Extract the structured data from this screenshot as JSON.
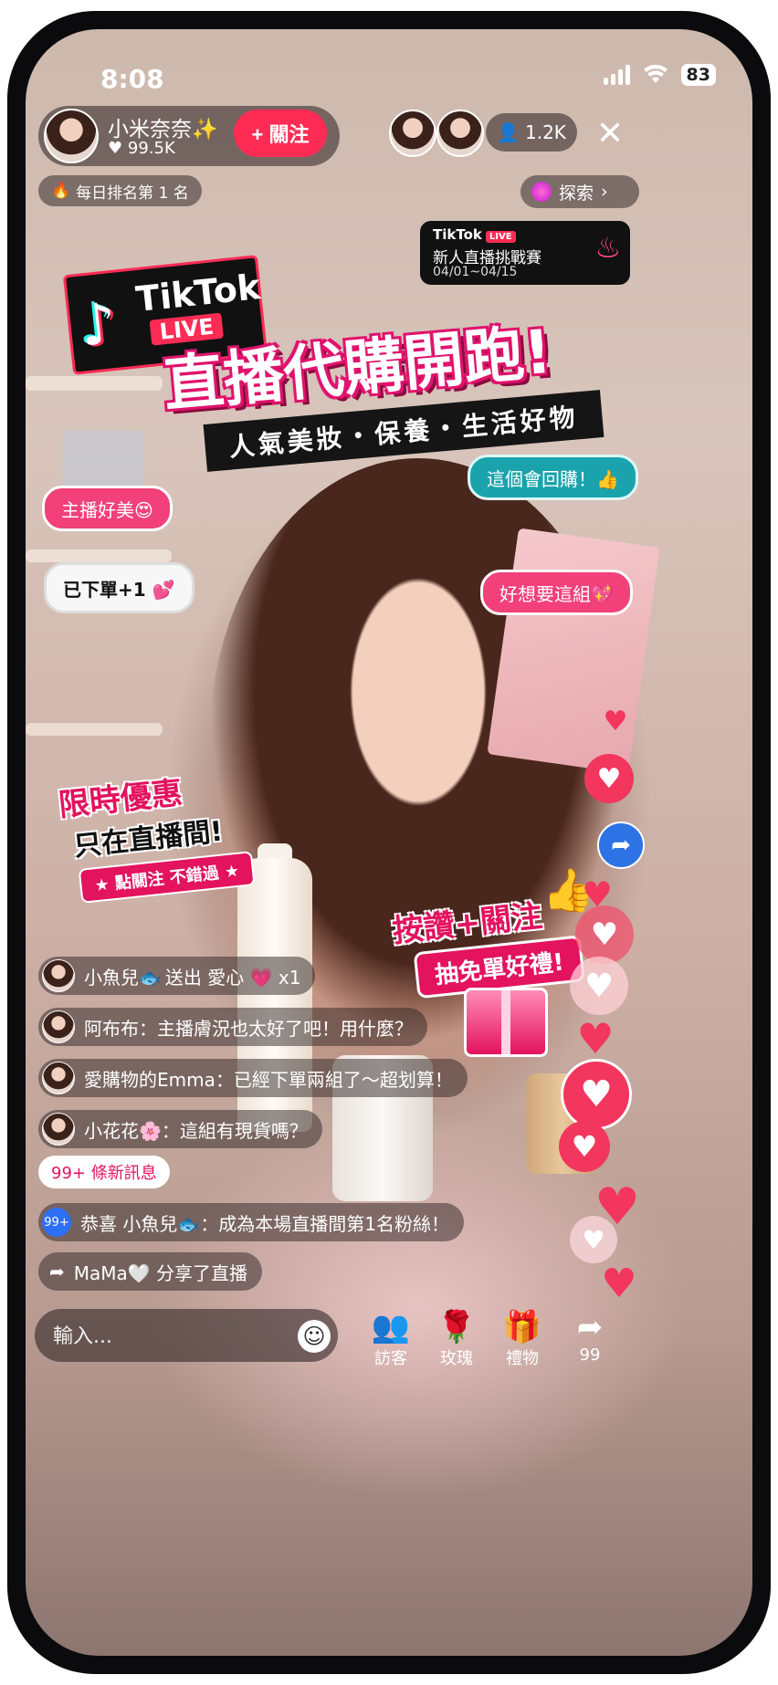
{
  "status": {
    "time": "8:08",
    "battery": "83"
  },
  "host": {
    "name": "小米奈奈✨",
    "likes": "99.5K",
    "follow_label": "+ 關注"
  },
  "viewers": {
    "count": "1.2K"
  },
  "rank": {
    "label": "每日排名第 1 名"
  },
  "explore": {
    "label": "探索"
  },
  "challenge": {
    "brand": "TikTok",
    "live": "LIVE",
    "title": "新人直播挑戰賽",
    "dates": "04/01~04/15"
  },
  "hero": {
    "logo_word": "TikTok",
    "logo_live": "LIVE",
    "headline": "直播代購開跑!",
    "subline": "人氣美妝・保養・生活好物"
  },
  "bubbles": {
    "b1": "主播好美😍",
    "b2": "已下單+1 💕",
    "b3": "這個會回購！👍",
    "b4": "好想要這組💖"
  },
  "promo": {
    "limited": "限時優惠",
    "only": "只在直播間!",
    "follow_tag": "★ 點關注 不錯過 ★",
    "like_follow": "按讚+關注",
    "free_gift": "抽免單好禮!"
  },
  "chat": [
    {
      "user": "小魚兒🐟",
      "text": "送出 愛心 💗 x1"
    },
    {
      "user": "阿布布：",
      "text": "主播膚況也太好了吧！用什麼？"
    },
    {
      "user": "愛購物的Emma：",
      "text": "已經下單兩組了～超划算！"
    },
    {
      "user": "小花花🌸：",
      "text": "這組有現貨嗎？"
    }
  ],
  "new_messages": "99+ 條新訊息",
  "system_badge": "99+",
  "system_msg": "恭喜 小魚兒🐟：成為本場直播間第1名粉絲！",
  "share_msg": "MaMa🤍 分享了直播",
  "input": {
    "placeholder": "輸入..."
  },
  "actions": [
    {
      "icon": "visitors-icon",
      "label": "訪客"
    },
    {
      "icon": "rose-icon",
      "label": "玫瑰"
    },
    {
      "icon": "gift-icon",
      "label": "禮物"
    },
    {
      "icon": "share-icon",
      "label": "99"
    }
  ],
  "colors": {
    "accent": "#fe2c55",
    "pink": "#f1407a",
    "teal": "#1aa3ac"
  }
}
